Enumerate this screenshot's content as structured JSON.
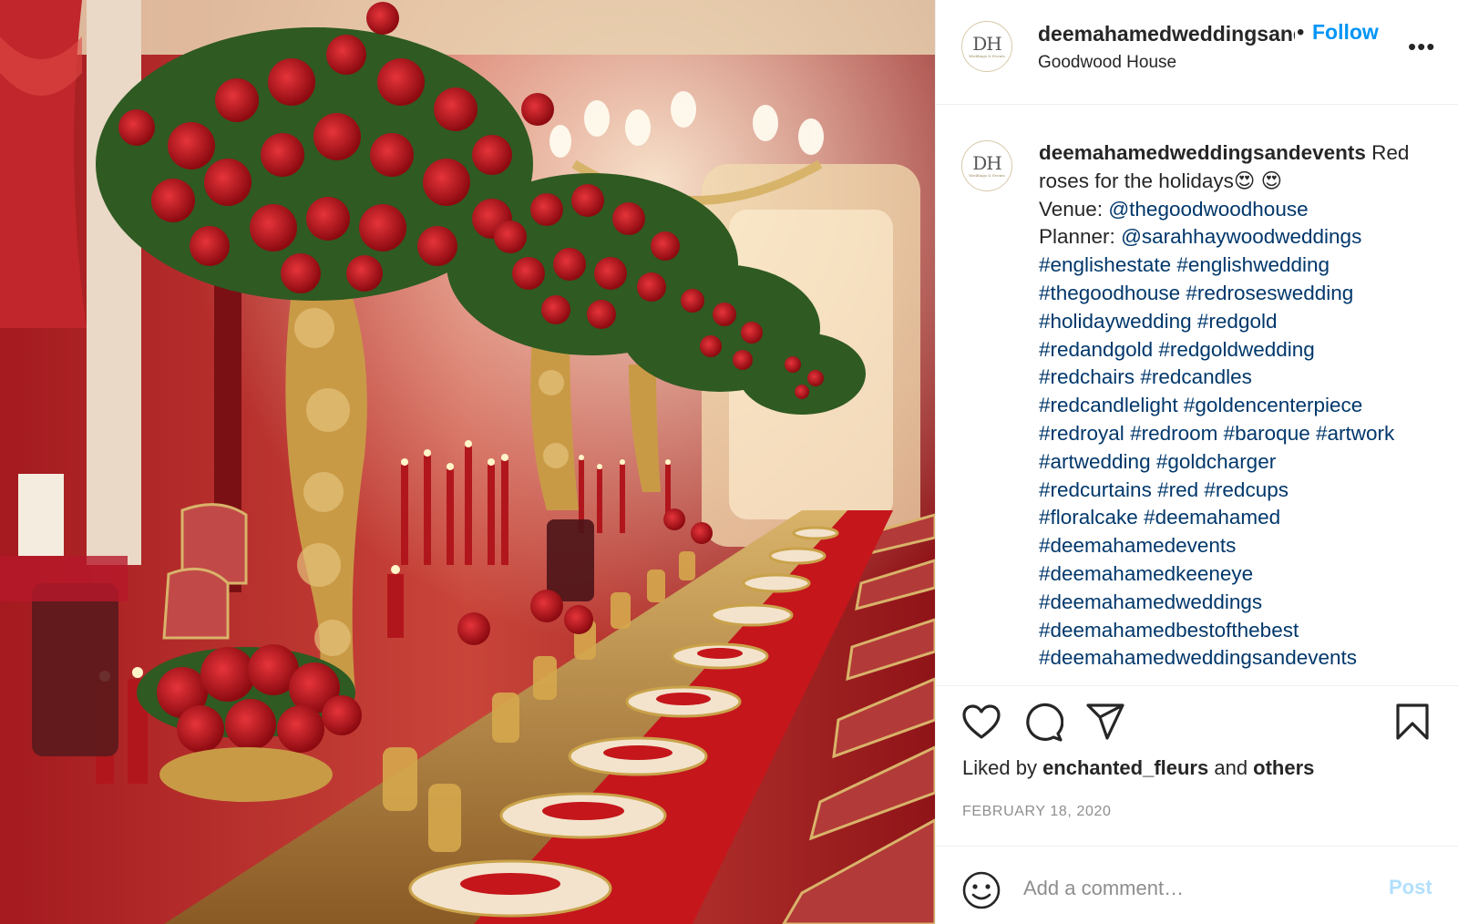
{
  "post": {
    "photo": {
      "icon": "wedding-table-photo",
      "palette": {
        "red": "#b3121b",
        "gold": "#c9a24a",
        "wall": "#9c1f22",
        "cream": "#f3e3cc"
      }
    },
    "header": {
      "avatar_initials": "DH",
      "avatar_subtitle": "Weddings & Events",
      "username": "deemahamedweddingsandevents",
      "separator": "•",
      "follow_label": "Follow",
      "location": "Goodwood House",
      "more_label": "•••"
    },
    "caption": {
      "username": "deemahamedweddingsandevents",
      "first_line_text": " Red",
      "second_line_text": "roses for the holidays😍 😍",
      "venue_label": "Venue: ",
      "venue_mention": "@thegoodwoodhouse",
      "planner_label": "Planner: ",
      "planner_mention": "@sarahhaywoodweddings",
      "hashtag_lines": [
        [
          "#englishestate",
          "#englishwedding"
        ],
        [
          "#thegoodhouse",
          "#redroseswedding"
        ],
        [
          "#holidaywedding",
          "#redgold"
        ],
        [
          "#redandgold",
          "#redgoldwedding"
        ],
        [
          "#redchairs",
          "#redcandles"
        ],
        [
          "#redcandlelight",
          "#goldencenterpiece"
        ],
        [
          "#redroyal",
          "#redroom",
          "#baroque",
          "#artwork"
        ],
        [
          "#artwedding",
          "#goldcharger"
        ],
        [
          "#redcurtains",
          "#red",
          "#redcups"
        ],
        [
          "#floralcake",
          "#deemahamed"
        ],
        [
          "#deemahamedevents"
        ],
        [
          "#deemahamedkeeneye"
        ],
        [
          "#deemahamedweddings"
        ],
        [
          "#deemahamedbestofthebest"
        ],
        [
          "#deemahamedweddingsandevents"
        ]
      ]
    },
    "actions": {
      "like_icon": "heart-icon",
      "comment_icon": "comment-icon",
      "share_icon": "share-icon",
      "save_icon": "bookmark-icon"
    },
    "likes": {
      "prefix": "Liked by ",
      "user": "enchanted_fleurs",
      "middle": " and ",
      "suffix": "others"
    },
    "date": "FEBRUARY 18, 2020",
    "comment": {
      "placeholder": "Add a comment…",
      "post_label": "Post",
      "emoji_icon": "smile-icon"
    },
    "colors": {
      "link": "#00376b",
      "follow": "#0095f6",
      "post_disabled": "#b2dffc",
      "muted": "#8e8e8e"
    }
  }
}
